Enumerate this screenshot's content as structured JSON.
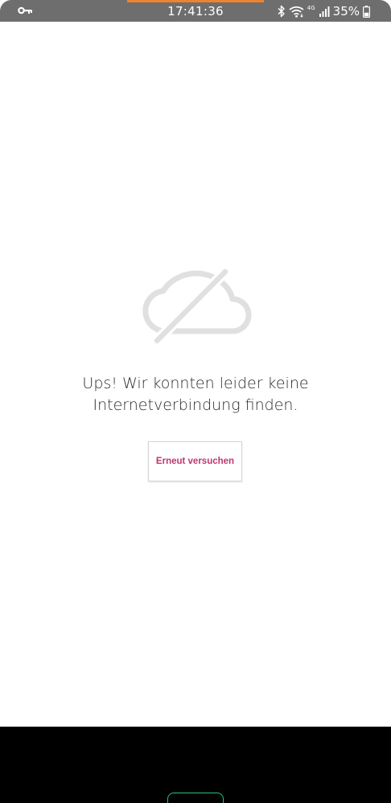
{
  "status_bar": {
    "time": "17:41:36",
    "network_type": "4G",
    "battery_percent": "35%",
    "icons": [
      "vpn-key-icon",
      "bluetooth-icon",
      "wifi-icon",
      "signal-icon",
      "battery-icon"
    ],
    "accent_color": "#f0832c"
  },
  "main": {
    "icon": "cloud-off-icon",
    "message_line1": "Ups! Wir konnten leider keine",
    "message_line2": "Internetverbindung finden.",
    "retry_label": "Erneut versuchen",
    "accent_color": "#c0366e"
  }
}
